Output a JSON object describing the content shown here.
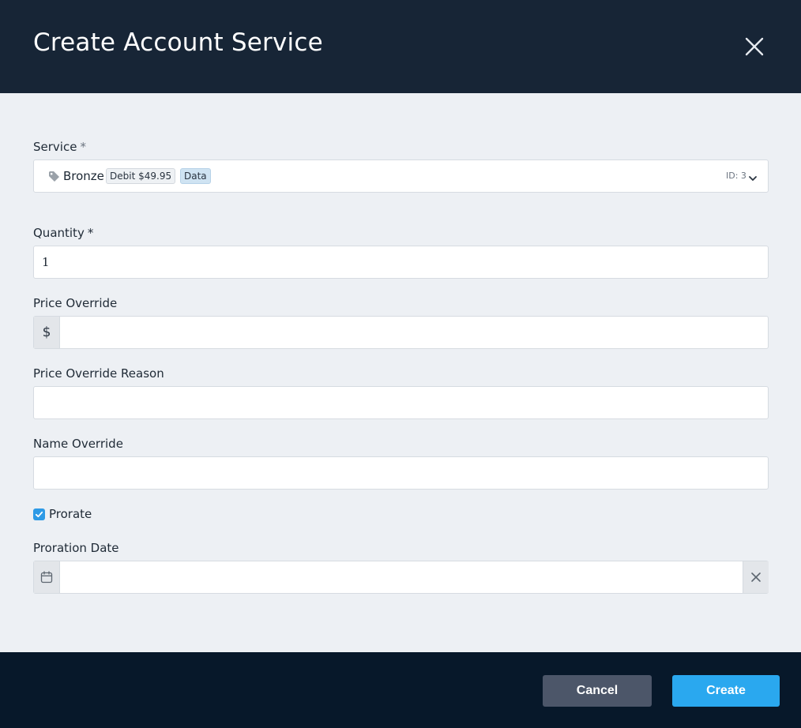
{
  "dialog": {
    "title": "Create Account Service",
    "close_icon": "close-icon"
  },
  "form": {
    "service": {
      "label": "Service",
      "required_mark": "*",
      "name": "Bronze",
      "badge_debit": "Debit $49.95",
      "badge_data": "Data",
      "id_text": "ID: 3",
      "icon": "tag-icon"
    },
    "quantity": {
      "label": "Quantity",
      "required_mark": "*",
      "value": "1"
    },
    "price_override": {
      "label": "Price Override",
      "prefix": "$",
      "value": ""
    },
    "price_override_reason": {
      "label": "Price Override Reason",
      "value": ""
    },
    "name_override": {
      "label": "Name Override",
      "value": ""
    },
    "prorate": {
      "label": "Prorate",
      "checked": true
    },
    "proration_date": {
      "label": "Proration Date",
      "value": "",
      "icon": "calendar-icon",
      "clear_icon": "close-icon"
    }
  },
  "footer": {
    "cancel_label": "Cancel",
    "create_label": "Create"
  },
  "colors": {
    "header_bg": "#172536",
    "footer_bg": "#07182a",
    "accent": "#2aa8ef",
    "cancel_bg": "#4c5669",
    "checkbox": "#2d9ae6"
  }
}
